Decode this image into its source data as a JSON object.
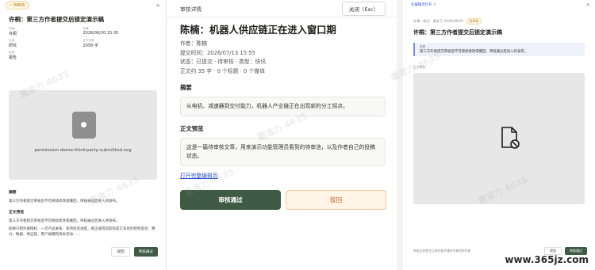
{
  "left": {
    "badge": "• 待审核",
    "close": "×",
    "title": "许桐：第三方作者提交后锁定演示稿",
    "meta": [
      {
        "key": "作者",
        "value": "许桐"
      },
      {
        "key": "创建",
        "value": "2026/06/20 15:35"
      },
      {
        "key": "分类",
        "value": "研究"
      },
      {
        "key": "正文字数",
        "value": "2058 字"
      },
      {
        "key": "标签",
        "value": "报告"
      }
    ],
    "file_name": "permission-demo-third-party-submitted.svg",
    "summary_heading": "摘要",
    "summary_text": "第三方作者提交审核后不可继续修改或撤回，审核通过后进入待发布。",
    "preview_heading": "正文预览",
    "preview_text_1": "第三方作者提交审核后不可继续修改或撤回，审核通过后进入待发布。",
    "preview_text_2": "如果只把外部授权、一次产品发布、某项投资进度，真正值得追踪的是它背后的结构变化：算力、数据、供应链、用户规模和资本流动……",
    "reject_label": "驳回",
    "approve_label": "审核通过"
  },
  "middle": {
    "header_label": "审核详情",
    "close_label": "关闭（Esc）",
    "title": "陈楠：机器人供应链正在进入窗口期",
    "author": "作者：陈楠",
    "submit_time": "提交时间：2026/07/13 15:55",
    "status": "状态：已提交 · 待审核 · 类型：快讯",
    "word_count": "正文约 35 字 · 0 个标题 · 0 个媒体",
    "summary_heading": "摘要",
    "summary_text": "从电机、减速器到交付能力，机器人产业链正在出现新的分工拐点。",
    "preview_heading": "正文预览",
    "preview_text": "这是一篇待审核文章，用来演示功能管理员看到的待审池，以及作者自己的投稿状态。",
    "edit_link": "打开完整编辑页",
    "approve_label": "审核通过",
    "reject_label": "驳回"
  },
  "right": {
    "open_in_editor": "在编辑页打开 ↗",
    "close": "×",
    "meta_text": "许桐 · 研究 · 提交于 2026/06/20",
    "status_badge": "待审核",
    "title": "许桐：第三方作者提交后锁定演示稿",
    "note_label": "摘要",
    "note_text": "第三方作者提交审核后不可继续修改或撤回，审核通过后进入待发布。",
    "section_label": "正文预览",
    "footer_text": "审核后变更会记录在案并通知作者和协作者",
    "reject_label": "驳回",
    "approve_label": "审核通过"
  },
  "watermark_text": "董道力 4635",
  "site_watermark": "www.365jz.com"
}
